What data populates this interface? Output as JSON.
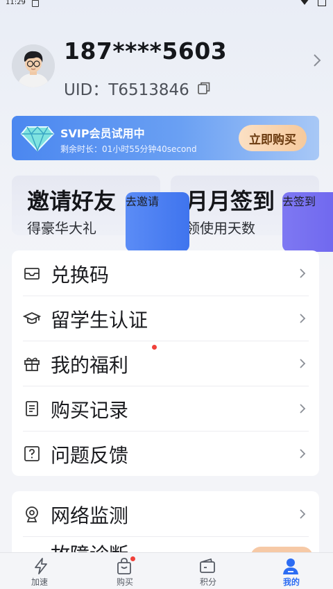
{
  "status": {
    "time": "11:29"
  },
  "profile": {
    "phone": "187****5603",
    "uid": "UID：T6513846"
  },
  "vip": {
    "title": "SVIP会员试用中",
    "remaining": "剩余时长：01小时55分钟40second",
    "buy_label": "立即购买"
  },
  "promos": [
    {
      "title": "邀请好友",
      "subtitle": "得豪华大礼",
      "button": "去邀请"
    },
    {
      "title": "月月签到",
      "subtitle": "领使用天数",
      "button": "去签到"
    }
  ],
  "menu1": [
    {
      "label": "兑换码",
      "icon": "mail-icon"
    },
    {
      "label": "留学生认证",
      "icon": "graduation-cap-icon"
    },
    {
      "label": "我的福利",
      "icon": "gift-icon"
    },
    {
      "label": "购买记录",
      "icon": "receipt-icon"
    },
    {
      "label": "问题反馈",
      "icon": "question-icon"
    }
  ],
  "menu2": [
    {
      "label": "网络监测",
      "icon": "network-monitor-icon"
    },
    {
      "label": "故障诊断",
      "icon": "diagnose-icon"
    }
  ],
  "tabs": [
    {
      "label": "加速",
      "icon": "lightning-icon"
    },
    {
      "label": "购买",
      "icon": "shopping-bag-icon"
    },
    {
      "label": "积分",
      "icon": "wallet-icon"
    },
    {
      "label": "我的",
      "icon": "user-icon"
    }
  ],
  "colors": {
    "accent": "#2c6cf3",
    "vip_blue": "#4b87f0",
    "badge_red": "#f0413a"
  }
}
